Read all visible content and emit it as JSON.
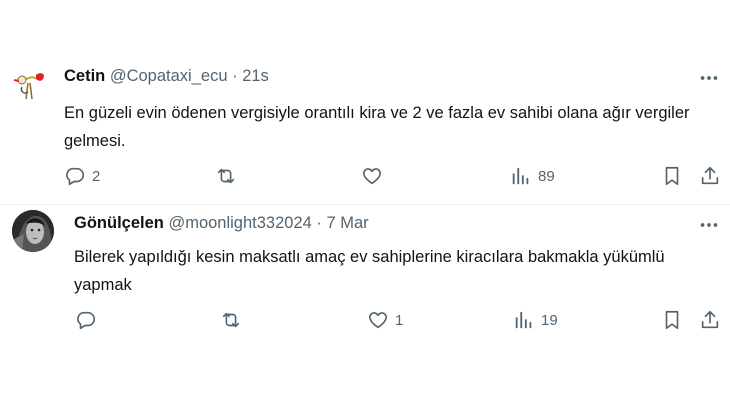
{
  "tweets": [
    {
      "name": "Cetin",
      "handle": "@Copataxi_ecu",
      "separator": "·",
      "time": "21s",
      "text": "En güzeli evin ödenen vergisiyle orantılı kira ve 2 ve fazla ev sahibi olana ağır vergiler gelmesi.",
      "replies": "2",
      "retweets": "",
      "likes": "",
      "views": "89"
    },
    {
      "name": "Gönülçelen",
      "handle": "@moonlight332024",
      "separator": "·",
      "time": "7 Mar",
      "text": "Bilerek yapıldığı kesin maksatlı amaç ev sahiplerine kiracılara bakmakla yükümlü yapmak",
      "replies": "",
      "retweets": "",
      "likes": "1",
      "views": "19"
    }
  ],
  "icons": {
    "reply": "reply-icon",
    "retweet": "retweet-icon",
    "like": "heart-icon",
    "views": "views-icon",
    "bookmark": "bookmark-icon",
    "share": "share-icon",
    "more": "more-icon"
  },
  "colors": {
    "text": "#0f1419",
    "secondary": "#536471",
    "divider": "#eff3f4"
  }
}
